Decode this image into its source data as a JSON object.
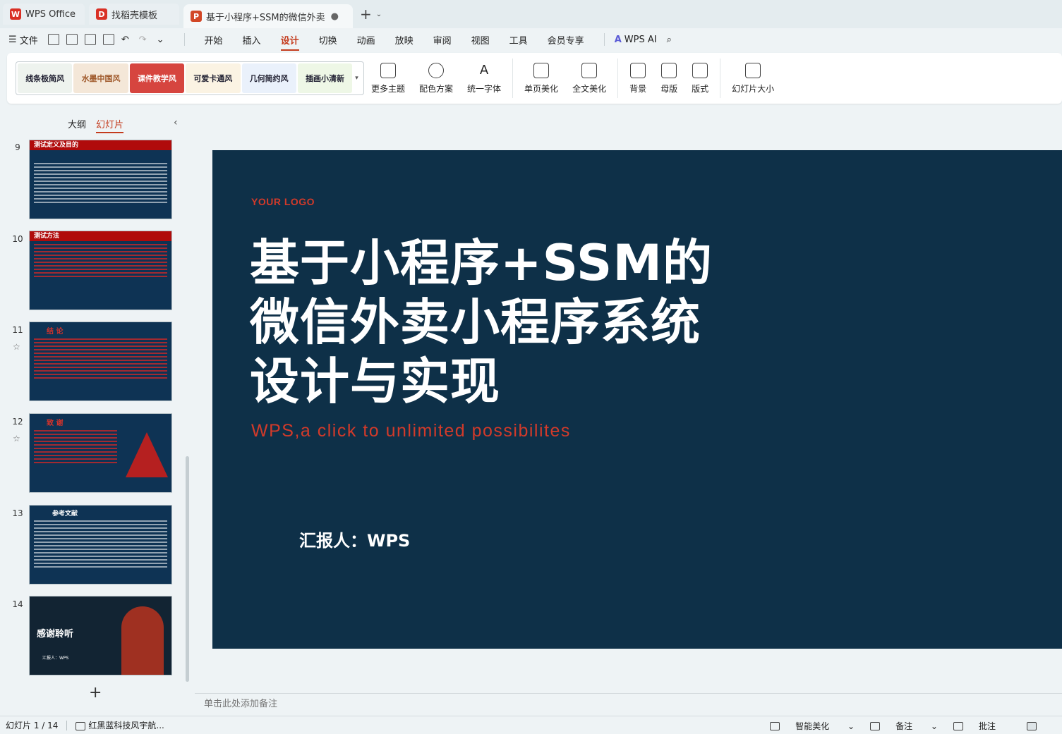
{
  "tabs": [
    {
      "label": "WPS Office",
      "icon": "wps-logo-icon",
      "color": "#d93025"
    },
    {
      "label": "找稻壳模板",
      "icon": "docer-logo-icon",
      "color": "#d93025"
    },
    {
      "label": "基于小程序+SSM的微信外卖",
      "icon": "ppt-logo-icon",
      "color": "#d24726",
      "active": true
    }
  ],
  "menu": {
    "file": "文件",
    "ribbon_tabs": [
      "开始",
      "插入",
      "设计",
      "切换",
      "动画",
      "放映",
      "审阅",
      "视图",
      "工具",
      "会员专享"
    ],
    "active_tab": "设计",
    "wps_ai": "WPS AI"
  },
  "ribbon": {
    "themes": [
      "线条极简风",
      "水墨中国风",
      "课件教学风",
      "可爱卡通风",
      "几何简约风",
      "插画小清新"
    ],
    "buttons_a": [
      {
        "label": "更多主题",
        "icon": "shirt-icon"
      },
      {
        "label": "配色方案",
        "icon": "palette-icon"
      },
      {
        "label": "统一字体",
        "icon": "font-icon"
      }
    ],
    "buttons_b": [
      {
        "label": "单页美化",
        "icon": "magic-page-icon"
      },
      {
        "label": "全文美化",
        "icon": "cube-icon"
      }
    ],
    "buttons_c": [
      {
        "label": "背景",
        "icon": "background-icon"
      },
      {
        "label": "母版",
        "icon": "master-icon"
      },
      {
        "label": "版式",
        "icon": "layout-icon"
      }
    ],
    "buttons_d": [
      {
        "label": "幻灯片大小",
        "icon": "slide-size-icon"
      }
    ]
  },
  "left_panel": {
    "tab_outline": "大纲",
    "tab_slides": "幻灯片",
    "thumbnails": [
      {
        "num": "9",
        "title": "测试定义及目的"
      },
      {
        "num": "10",
        "title": "测试方法"
      },
      {
        "num": "11",
        "title": "结 论"
      },
      {
        "num": "12",
        "title": "致 谢"
      },
      {
        "num": "13",
        "title": "参考文献"
      },
      {
        "num": "14",
        "title": "感谢聆听",
        "sub": "汇报人：WPS"
      }
    ]
  },
  "slide": {
    "logo": "YOUR LOGO",
    "title_lines": [
      "基于小程序+SSM的",
      "微信外卖小程序系统",
      "设计与实现"
    ],
    "subtitle": "WPS,a click to unlimited possibilites",
    "reporter": "汇报人：WPS",
    "bg_color": "#0e3048",
    "accent_color": "#d23a2a"
  },
  "notes_placeholder": "单击此处添加备注",
  "status": {
    "slide_count": "幻灯片 1 / 14",
    "theme_name": "红黑蓝科技风宇航...",
    "smart_beautify": "智能美化",
    "notes": "备注",
    "comments": "批注"
  }
}
